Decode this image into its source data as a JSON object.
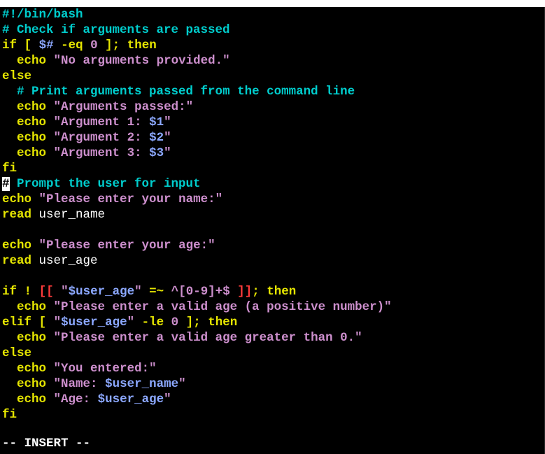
{
  "editor": {
    "lines": [
      [
        [
          "c-comment",
          "#!/bin/bash"
        ]
      ],
      [
        [
          "c-comment",
          "# Check if arguments are passed"
        ]
      ],
      [
        [
          "c-keyword",
          "if"
        ],
        [
          "c-normal",
          " "
        ],
        [
          "c-keyword",
          "["
        ],
        [
          "c-normal",
          " "
        ],
        [
          "c-var",
          "$#"
        ],
        [
          "c-normal",
          " "
        ],
        [
          "c-keyword",
          "-eq"
        ],
        [
          "c-normal",
          " "
        ],
        [
          "c-string",
          "0"
        ],
        [
          "c-normal",
          " "
        ],
        [
          "c-keyword",
          "];"
        ],
        [
          "c-normal",
          " "
        ],
        [
          "c-keyword",
          "then"
        ]
      ],
      [
        [
          "c-normal",
          "  "
        ],
        [
          "c-keyword",
          "echo"
        ],
        [
          "c-normal",
          " "
        ],
        [
          "c-string",
          "\"No arguments provided.\""
        ]
      ],
      [
        [
          "c-keyword",
          "else"
        ]
      ],
      [
        [
          "c-normal",
          "  "
        ],
        [
          "c-comment",
          "# Print arguments passed from the command line"
        ]
      ],
      [
        [
          "c-normal",
          "  "
        ],
        [
          "c-keyword",
          "echo"
        ],
        [
          "c-normal",
          " "
        ],
        [
          "c-string",
          "\"Arguments passed:\""
        ]
      ],
      [
        [
          "c-normal",
          "  "
        ],
        [
          "c-keyword",
          "echo"
        ],
        [
          "c-normal",
          " "
        ],
        [
          "c-string",
          "\"Argument 1: "
        ],
        [
          "c-var",
          "$1"
        ],
        [
          "c-string",
          "\""
        ]
      ],
      [
        [
          "c-normal",
          "  "
        ],
        [
          "c-keyword",
          "echo"
        ],
        [
          "c-normal",
          " "
        ],
        [
          "c-string",
          "\"Argument 2: "
        ],
        [
          "c-var",
          "$2"
        ],
        [
          "c-string",
          "\""
        ]
      ],
      [
        [
          "c-normal",
          "  "
        ],
        [
          "c-keyword",
          "echo"
        ],
        [
          "c-normal",
          " "
        ],
        [
          "c-string",
          "\"Argument 3: "
        ],
        [
          "c-var",
          "$3"
        ],
        [
          "c-string",
          "\""
        ]
      ],
      [
        [
          "c-keyword",
          "fi"
        ]
      ],
      [
        [
          "c-cursor",
          "#"
        ],
        [
          "c-comment",
          " Prompt the user for input"
        ]
      ],
      [
        [
          "c-keyword",
          "echo"
        ],
        [
          "c-normal",
          " "
        ],
        [
          "c-string",
          "\"Please enter your name:\""
        ]
      ],
      [
        [
          "c-keyword",
          "read"
        ],
        [
          "c-normal",
          " "
        ],
        [
          "c-plain",
          "user_name"
        ]
      ],
      [],
      [
        [
          "c-keyword",
          "echo"
        ],
        [
          "c-normal",
          " "
        ],
        [
          "c-string",
          "\"Please enter your age:\""
        ]
      ],
      [
        [
          "c-keyword",
          "read"
        ],
        [
          "c-normal",
          " "
        ],
        [
          "c-plain",
          "user_age"
        ]
      ],
      [],
      [
        [
          "c-keyword",
          "if"
        ],
        [
          "c-normal",
          " "
        ],
        [
          "c-keyword",
          "!"
        ],
        [
          "c-normal",
          " "
        ],
        [
          "c-red",
          "[["
        ],
        [
          "c-normal",
          " "
        ],
        [
          "c-string",
          "\""
        ],
        [
          "c-var",
          "$user_age"
        ],
        [
          "c-string",
          "\""
        ],
        [
          "c-normal",
          " "
        ],
        [
          "c-keyword",
          "=~"
        ],
        [
          "c-normal",
          " "
        ],
        [
          "c-string",
          "^[0-9]+$"
        ],
        [
          "c-normal",
          " "
        ],
        [
          "c-red",
          "]]"
        ],
        [
          "c-keyword",
          ";"
        ],
        [
          "c-normal",
          " "
        ],
        [
          "c-keyword",
          "then"
        ]
      ],
      [
        [
          "c-normal",
          "  "
        ],
        [
          "c-keyword",
          "echo"
        ],
        [
          "c-normal",
          " "
        ],
        [
          "c-string",
          "\"Please enter a valid age (a positive number)\""
        ]
      ],
      [
        [
          "c-keyword",
          "elif"
        ],
        [
          "c-normal",
          " "
        ],
        [
          "c-keyword",
          "["
        ],
        [
          "c-normal",
          " "
        ],
        [
          "c-string",
          "\""
        ],
        [
          "c-var",
          "$user_age"
        ],
        [
          "c-string",
          "\""
        ],
        [
          "c-normal",
          " "
        ],
        [
          "c-keyword",
          "-le"
        ],
        [
          "c-normal",
          " "
        ],
        [
          "c-string",
          "0"
        ],
        [
          "c-normal",
          " "
        ],
        [
          "c-keyword",
          "];"
        ],
        [
          "c-normal",
          " "
        ],
        [
          "c-keyword",
          "then"
        ]
      ],
      [
        [
          "c-normal",
          "  "
        ],
        [
          "c-keyword",
          "echo"
        ],
        [
          "c-normal",
          " "
        ],
        [
          "c-string",
          "\"Please enter a valid age greater than 0.\""
        ]
      ],
      [
        [
          "c-keyword",
          "else"
        ]
      ],
      [
        [
          "c-normal",
          "  "
        ],
        [
          "c-keyword",
          "echo"
        ],
        [
          "c-normal",
          " "
        ],
        [
          "c-string",
          "\"You entered:\""
        ]
      ],
      [
        [
          "c-normal",
          "  "
        ],
        [
          "c-keyword",
          "echo"
        ],
        [
          "c-normal",
          " "
        ],
        [
          "c-string",
          "\"Name: "
        ],
        [
          "c-var",
          "$user_name"
        ],
        [
          "c-string",
          "\""
        ]
      ],
      [
        [
          "c-normal",
          "  "
        ],
        [
          "c-keyword",
          "echo"
        ],
        [
          "c-normal",
          " "
        ],
        [
          "c-string",
          "\"Age: "
        ],
        [
          "c-var",
          "$user_age"
        ],
        [
          "c-string",
          "\""
        ]
      ],
      [
        [
          "c-keyword",
          "fi"
        ]
      ]
    ]
  },
  "status": {
    "mode_text": "-- INSERT --"
  },
  "colors": {
    "background": "#000000",
    "comment": "#00cdcd",
    "keyword": "#e5e500",
    "string": "#cd8fcd",
    "variable": "#8ca8ff",
    "error_bracket": "#ff3b3b",
    "text": "#ffffff"
  }
}
